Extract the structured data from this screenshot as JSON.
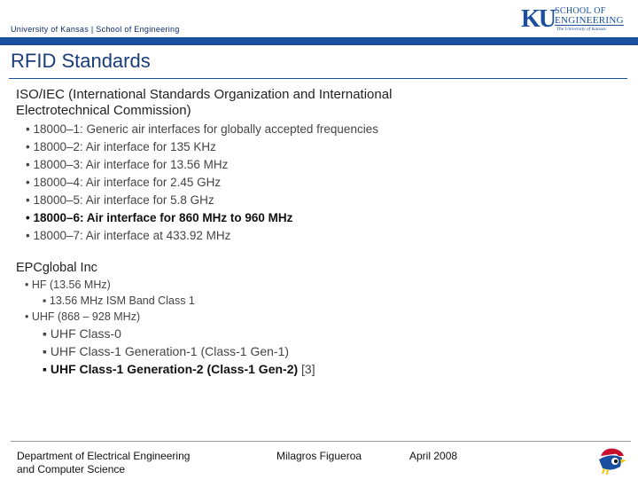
{
  "header": {
    "org_text": "University of Kansas | School of Engineering",
    "logo_mark": "KU",
    "logo_school_line1": "SCHOOL OF",
    "logo_school_line2": "ENGINEERING",
    "logo_univ": "The University of Kansas"
  },
  "slide": {
    "title": "RFID Standards",
    "section1": {
      "heading_line1": "ISO/IEC (International Standards Organization and International",
      "heading_line2": "Electrotechnical Commission)",
      "items": [
        "• 18000–1: Generic air interfaces for globally accepted frequencies",
        "• 18000–2: Air interface for 135 KHz",
        "• 18000–3: Air interface for 13.56 MHz",
        "• 18000–4: Air interface for 2.45 GHz",
        "• 18000–5: Air interface for 5.8 GHz",
        "• 18000–6: Air interface for 860 MHz to 960 MHz",
        "• 18000–7: Air interface at 433.92 MHz"
      ]
    },
    "section2": {
      "heading": "EPCglobal Inc",
      "hf": "• HF (13.56 MHz)",
      "hf_items": [
        "▪ 13.56 MHz ISM Band Class 1"
      ],
      "uhf": "• UHF (868 – 928 MHz)",
      "uhf_items": [
        "▪ UHF Class-0",
        "▪ UHF Class-1 Generation-1 (Class-1 Gen-1)",
        "▪ UHF Class-1 Generation-2 (Class-1 Gen-2)"
      ],
      "ref": " [3]"
    }
  },
  "footer": {
    "dept_line1": "Department of Electrical Engineering",
    "dept_line2": "and Computer Science",
    "author": "Milagros Figueroa",
    "date": "April 2008"
  },
  "colors": {
    "accent": "#1a4fa0",
    "title": "#1a3d7a"
  }
}
